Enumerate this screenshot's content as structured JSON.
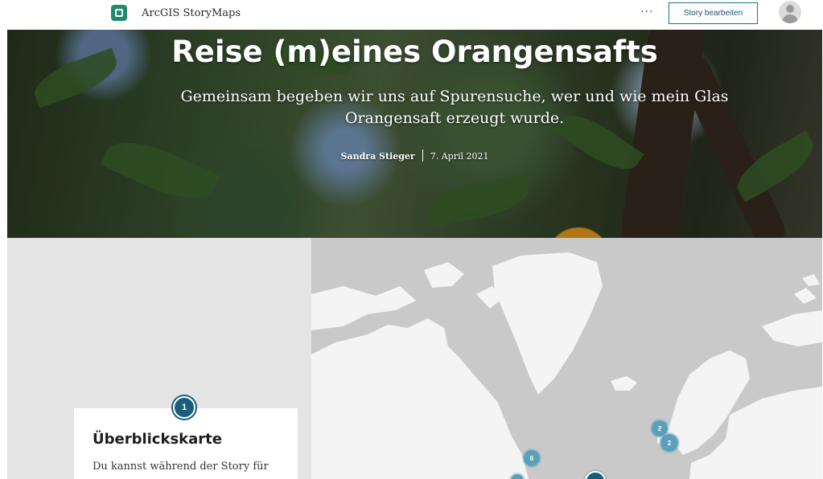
{
  "header": {
    "brand": "ArcGIS StoryMaps",
    "more_label": "···",
    "edit_button": "Story bearbeiten"
  },
  "hero": {
    "title": "Reise (m)eines Orangensafts",
    "subtitle": "Gemeinsam begeben wir uns auf Spurensuche, wer und wie mein Glas Orangensaft erzeugt wurde.",
    "author": "Sandra Stieger",
    "date": "7. April 2021"
  },
  "card": {
    "number": "1",
    "title": "Überblickskarte",
    "text": "Du kannst während der Story für"
  },
  "map": {
    "markers": [
      {
        "label": "6"
      },
      {
        "label": "2"
      },
      {
        "label": "2"
      },
      {
        "label": ""
      },
      {
        "label": ""
      }
    ],
    "colors": {
      "land": "#f4f4f4",
      "water": "#c9c9c9",
      "marker": "#5aa0b8",
      "marker_active": "#1a5e7a"
    }
  },
  "icons": {
    "logo": "storymaps-logo-icon",
    "avatar": "user-avatar-icon"
  }
}
